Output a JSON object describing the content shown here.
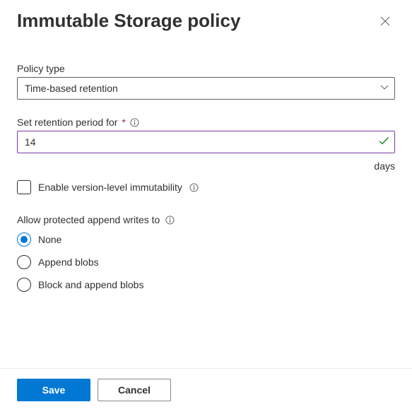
{
  "header": {
    "title": "Immutable Storage policy"
  },
  "policy_type": {
    "label": "Policy type",
    "value": "Time-based retention"
  },
  "retention": {
    "label": "Set retention period for",
    "required_mark": "*",
    "value": "14",
    "unit": "days"
  },
  "version_immutability": {
    "label": "Enable version-level immutability",
    "checked": false
  },
  "append_writes": {
    "label": "Allow protected append writes to",
    "options": [
      {
        "key": "none",
        "label": "None",
        "selected": true
      },
      {
        "key": "append",
        "label": "Append blobs",
        "selected": false
      },
      {
        "key": "both",
        "label": "Block and append blobs",
        "selected": false
      }
    ]
  },
  "footer": {
    "save": "Save",
    "cancel": "Cancel"
  }
}
